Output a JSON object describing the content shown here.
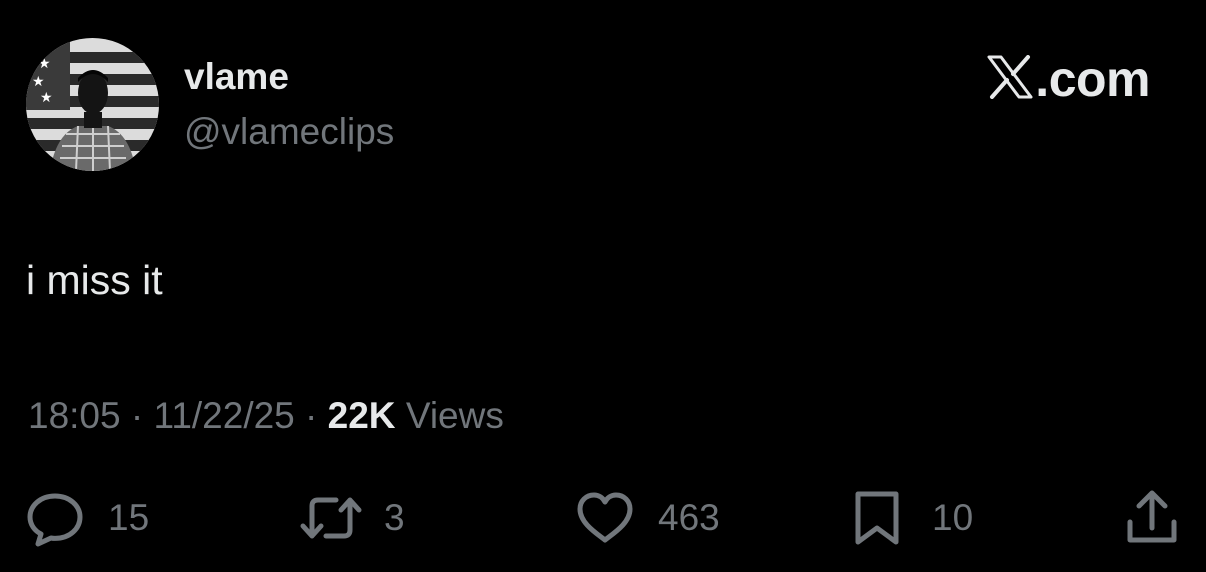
{
  "author": {
    "display_name": "vlame",
    "handle": "@vlameclips"
  },
  "brand": {
    "label": ".com"
  },
  "tweet": {
    "text": "i miss it",
    "time": "18:05",
    "separator": "·",
    "date": "11/22/25",
    "views_count": "22K",
    "views_label": "Views"
  },
  "actions": {
    "replies": "15",
    "reposts": "3",
    "likes": "463",
    "bookmarks": "10"
  },
  "icons": {
    "reply": "reply-icon",
    "repost": "repost-icon",
    "like": "heart-icon",
    "bookmark": "bookmark-icon",
    "share": "share-icon",
    "brand": "x-logo-icon"
  },
  "colors": {
    "background": "#000000",
    "primary_text": "#e7e9ea",
    "secondary_text": "#71767b"
  }
}
